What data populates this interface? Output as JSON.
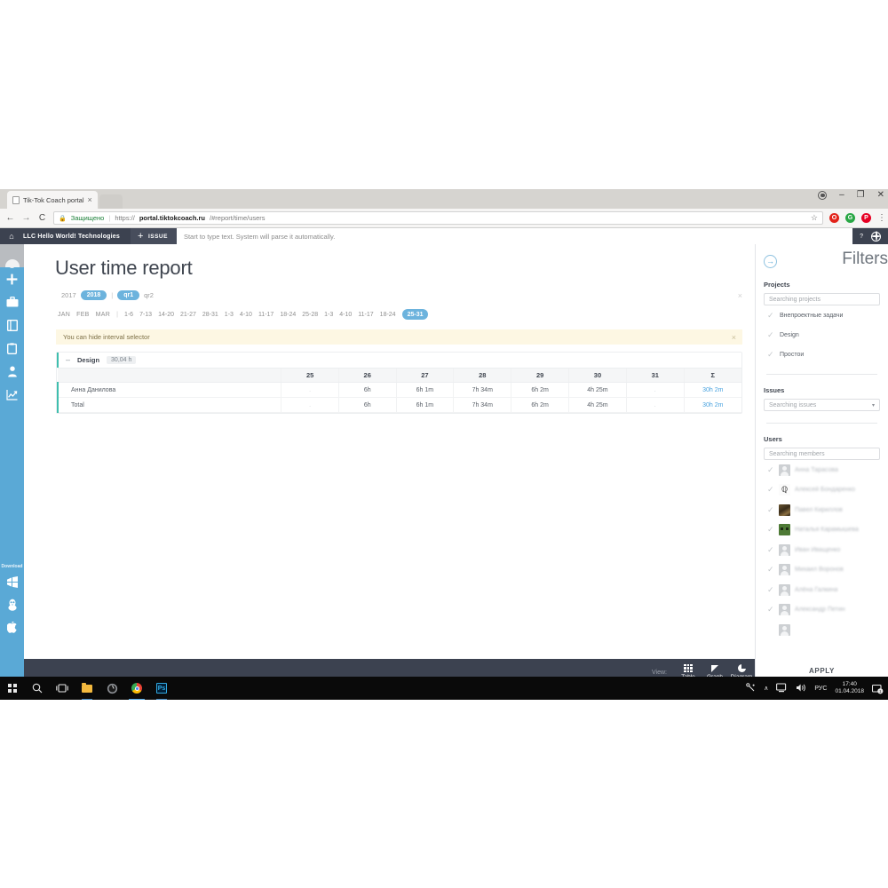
{
  "browser": {
    "tab_title": "Tik-Tok Coach portal",
    "tab_close": "×",
    "back_icon": "←",
    "forward_icon": "→",
    "reload_icon": "C",
    "secure_label": "Защищено",
    "lock_icon": "🔒",
    "url_scheme": "https://",
    "url_host": "portal.tiktokcoach.ru",
    "url_path": "/#report/time/users",
    "star_icon": "☆",
    "kebab_icon": "⋮",
    "extensions": [
      {
        "name": "opera-extension",
        "glyph": "O",
        "color": "#e2231a"
      },
      {
        "name": "green-extension",
        "glyph": "G",
        "color": "#29a745"
      },
      {
        "name": "pinterest-extension",
        "glyph": "P",
        "color": "#e60023"
      }
    ],
    "window_minimize": "–",
    "window_maximize": "❐",
    "window_close": "✕"
  },
  "appnav": {
    "home_icon": "⌂",
    "brand": "LLC Hello World! Technologies",
    "issue_plus": "+",
    "issue_label": "ISSUE",
    "search_placeholder": "Start to type text. System will parse it automatically.",
    "help_icon": "?",
    "globe_icon": "globe-icon"
  },
  "rail": {
    "items": [
      {
        "name": "avatar",
        "glyph": ""
      },
      {
        "name": "add",
        "glyph": "+"
      },
      {
        "name": "briefcase",
        "glyph": "💼"
      },
      {
        "name": "book",
        "glyph": "▥"
      },
      {
        "name": "clipboard",
        "glyph": "📋"
      },
      {
        "name": "person",
        "glyph": "👤"
      },
      {
        "name": "chart",
        "glyph": "📈"
      }
    ],
    "download_label": "Download",
    "download_items": [
      {
        "name": "windows",
        "glyph": "⊞"
      },
      {
        "name": "linux",
        "glyph": "🐧"
      },
      {
        "name": "apple",
        "glyph": ""
      }
    ]
  },
  "report": {
    "title": "User time report",
    "years": [
      {
        "label": "2017",
        "selected": false
      },
      {
        "label": "2018",
        "selected": true
      }
    ],
    "year_sep": "|",
    "quarters": [
      {
        "label": "qr1",
        "selected": true
      },
      {
        "label": "qr2",
        "selected": false
      }
    ],
    "months": [
      "JAN",
      "FEB",
      "MAR"
    ],
    "month_sep": "|",
    "weeks": [
      "1-6",
      "7-13",
      "14-20",
      "21-27",
      "28-31",
      "1-3",
      "4-10",
      "11-17",
      "18-24",
      "25-28",
      "1-3",
      "4-10",
      "11-17",
      "18-24"
    ],
    "week_selected": "25-31",
    "close_icon": "×",
    "notice": "You can hide interval selector"
  },
  "table": {
    "group_toggle": "–",
    "group_name": "Design",
    "group_total": "30,04 h",
    "columns": [
      "",
      "25",
      "26",
      "27",
      "28",
      "29",
      "30",
      "31",
      "Σ"
    ],
    "rows": [
      {
        "name": "Анна Данилова",
        "cells": [
          ".",
          "6h",
          "6h 1m",
          "7h 34m",
          "6h 2m",
          "4h 25m",
          "."
        ],
        "sum": "30h 2m"
      },
      {
        "name": "Total",
        "cells": [
          ".",
          "6h",
          "6h 1m",
          "7h 34m",
          "6h 2m",
          "4h 25m",
          "."
        ],
        "sum": "30h 2m"
      }
    ]
  },
  "filters": {
    "collapse_icon": "→",
    "title": "Filters",
    "projects_label": "Projects",
    "projects_placeholder": "Searching projects",
    "projects": [
      {
        "label": "Внепроектные задачи",
        "checked": true
      },
      {
        "label": "Design",
        "checked": true
      },
      {
        "label": "Простои",
        "checked": true
      }
    ],
    "issues_label": "Issues",
    "issues_placeholder": "Searching issues",
    "issues_caret": "▾",
    "users_label": "Users",
    "users_placeholder": "Searching members",
    "check_icon": "✓",
    "users": [
      {
        "label": "Анна Тарасова",
        "avatar": "generic"
      },
      {
        "label": "Алексей Бондаренко",
        "avatar": "signature"
      },
      {
        "label": "Павел Кириллов",
        "avatar": "artwork"
      },
      {
        "label": "Наталья Карамышева",
        "avatar": "green"
      },
      {
        "label": "Иван Иващенко",
        "avatar": "generic"
      },
      {
        "label": "Михаил Воронов",
        "avatar": "generic"
      },
      {
        "label": "Алёна Галкина",
        "avatar": "generic"
      },
      {
        "label": "Александр Петин",
        "avatar": "generic"
      }
    ],
    "apply_label": "APPLY"
  },
  "viewbar": {
    "label": "View:",
    "options": [
      {
        "label": "Table",
        "icon": "grid-icon"
      },
      {
        "label": "Graph",
        "icon": "triangle-icon"
      },
      {
        "label": "Diagram",
        "icon": "pie-icon"
      }
    ]
  },
  "taskbar": {
    "start_icon": "windows-start-icon",
    "search_icon": "⚲",
    "taskview_icon": "▭",
    "explorer_icon": "folder-icon",
    "edge_icon": "◌",
    "chrome_icon": "chrome-icon",
    "photoshop_icon": "Ps",
    "tray_pen_icon": "✎",
    "tray_chevron": "∧",
    "tray_network_icon": "🖥",
    "tray_volume_icon": "🔊",
    "tray_lang": "РУС",
    "time": "17:40",
    "date": "01.04.2018"
  }
}
